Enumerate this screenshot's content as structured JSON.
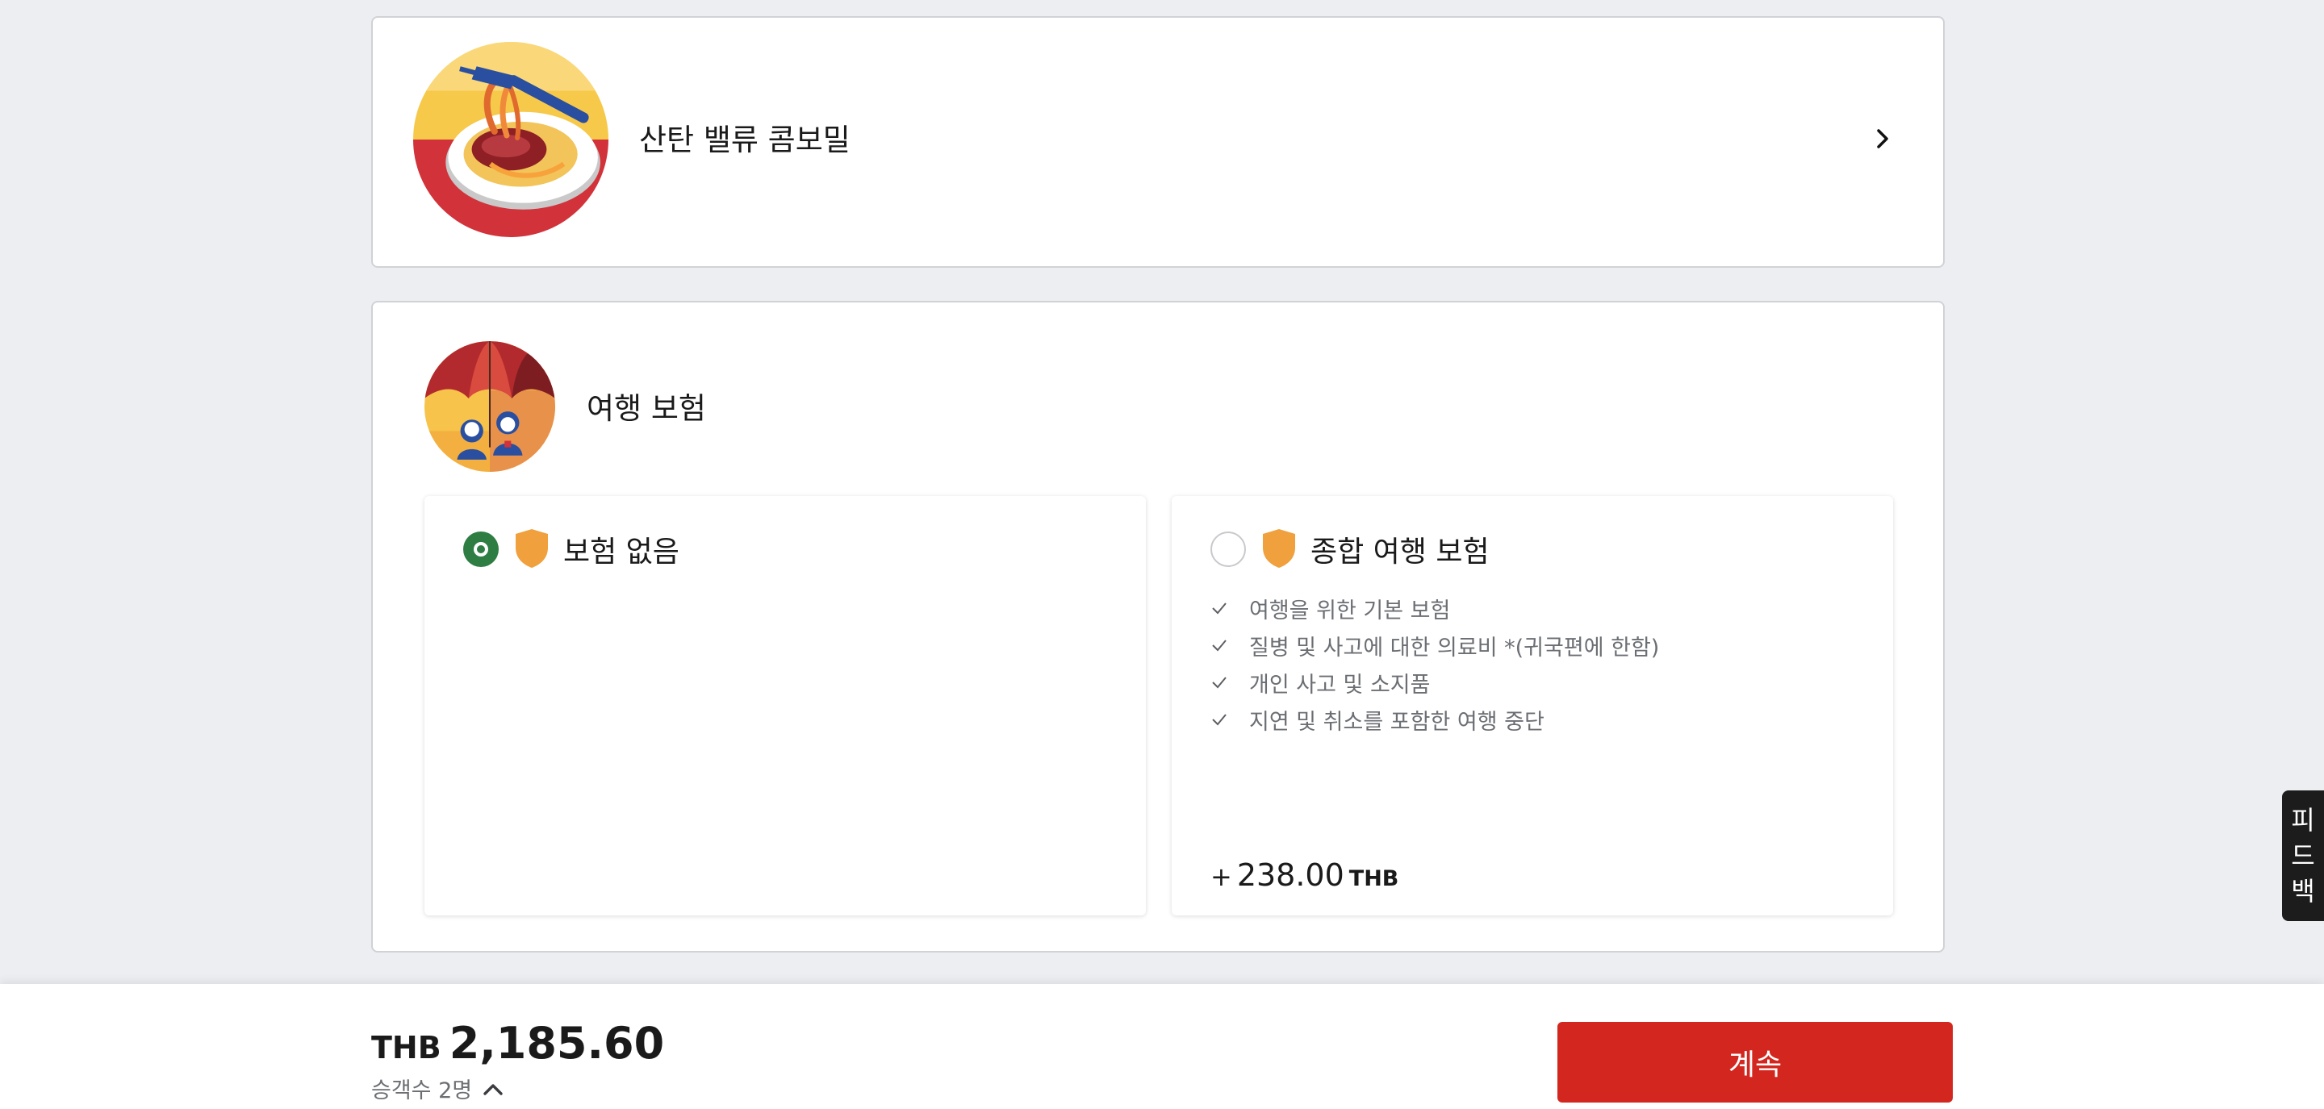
{
  "meal": {
    "title": "산탄 밸류 콤보밀",
    "icon": "pasta-meal-icon",
    "action_icon": "chevron-right-icon"
  },
  "insurance": {
    "title": "여행 보험",
    "icon": "umbrella-travelers-icon",
    "options": [
      {
        "title": "보험 없음",
        "selected": true,
        "icon": "shield-icon"
      },
      {
        "title": "종합 여행 보험",
        "selected": false,
        "icon": "shield-icon",
        "benefits": [
          "여행을 위한 기본 보험",
          "질병 및 사고에 대한 의료비 *(귀국편에 한함)",
          "개인 사고 및 소지품",
          "지연 및 취소를 포함한 여행 중단"
        ],
        "price_prefix": "+",
        "price": "238.00",
        "currency": "THB"
      }
    ]
  },
  "footer": {
    "currency": "THB",
    "total": "2,185.60",
    "passengers_label": "승객수 2명",
    "continue_label": "계속"
  },
  "feedback": {
    "chars": [
      "피",
      "드",
      "백"
    ]
  },
  "colors": {
    "accent_red": "#d3261e",
    "selected_green": "#2e7d43",
    "shield_orange": "#f0a03c",
    "background": "#edeef1"
  }
}
